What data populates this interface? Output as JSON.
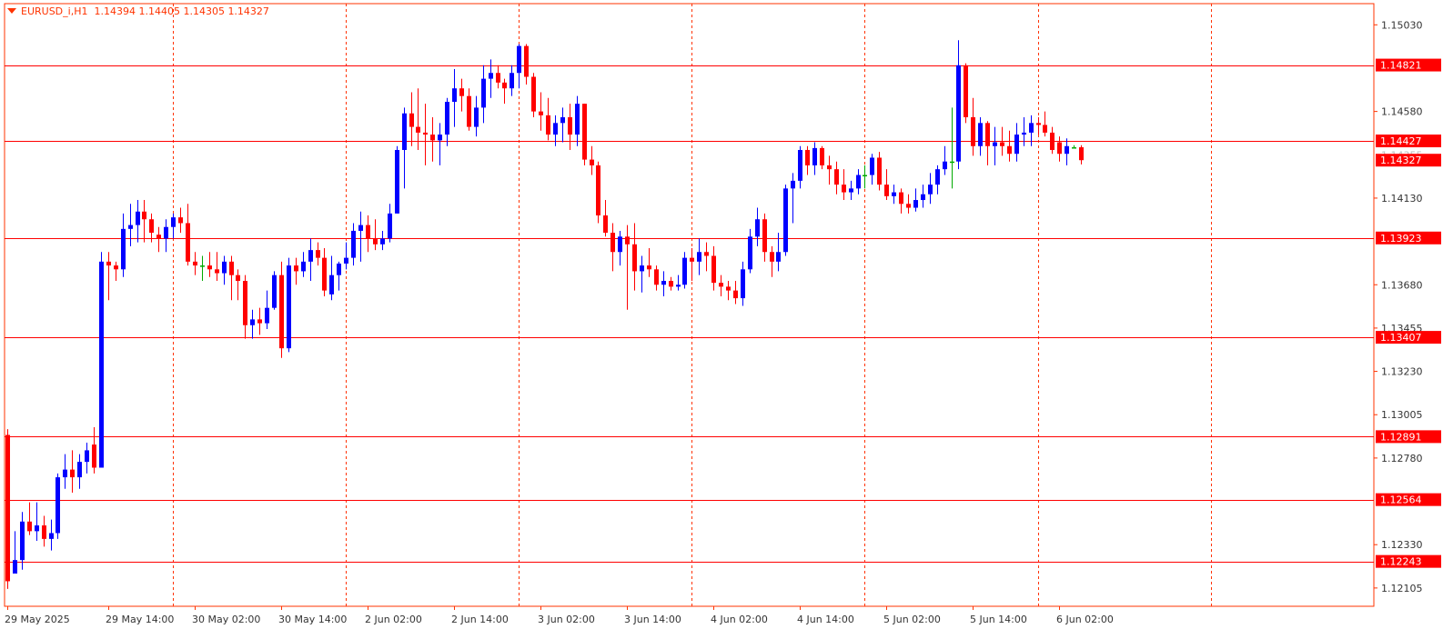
{
  "header": {
    "symbol": "EURUSD_i,H1",
    "ohlc": "1.14394 1.14405 1.14305 1.14327"
  },
  "colors": {
    "background": "#ffffff",
    "frame": "#ff3300",
    "grid": "#ff3300",
    "bull": "#0000ff",
    "bear": "#ff0000",
    "doji": "#00aa00",
    "hline": "#ff0000",
    "label_text": "#ffffff",
    "label_bg": "#ff0000"
  },
  "chart_data": {
    "type": "candlestick",
    "timeframe": "H1",
    "ylim": [
      1.1201,
      1.1514
    ],
    "price_ticks": [
      "1.15030",
      "1.14580",
      "1.14130",
      "1.13680",
      "1.13455",
      "1.13230",
      "1.13005",
      "1.12780",
      "1.12330",
      "1.12105"
    ],
    "time_labels": [
      {
        "label": "29 May 2025",
        "bar": 0
      },
      {
        "label": "29 May 14:00",
        "bar": 14
      },
      {
        "label": "30 May 02:00",
        "bar": 26
      },
      {
        "label": "30 May 14:00",
        "bar": 38
      },
      {
        "label": "2 Jun 02:00",
        "bar": 50
      },
      {
        "label": "2 Jun 14:00",
        "bar": 62
      },
      {
        "label": "3 Jun 02:00",
        "bar": 74
      },
      {
        "label": "3 Jun 14:00",
        "bar": 86
      },
      {
        "label": "4 Jun 02:00",
        "bar": 98
      },
      {
        "label": "4 Jun 14:00",
        "bar": 110
      },
      {
        "label": "5 Jun 02:00",
        "bar": 122
      },
      {
        "label": "5 Jun 14:00",
        "bar": 134
      },
      {
        "label": "6 Jun 02:00",
        "bar": 146
      }
    ],
    "grid_bars": [
      23,
      47,
      71,
      95,
      119,
      143,
      167
    ],
    "horizontal_levels": [
      {
        "value": 1.14821,
        "label": "1.14821"
      },
      {
        "value": 1.14427,
        "label": "1.14427"
      },
      {
        "value": 1.13923,
        "label": "1.13923"
      },
      {
        "value": 1.13407,
        "label": "1.13407"
      },
      {
        "value": 1.12891,
        "label": "1.12891"
      },
      {
        "value": 1.12564,
        "label": "1.12564"
      },
      {
        "value": 1.12243,
        "label": "1.12243"
      }
    ],
    "price_marker": {
      "value": 1.14327,
      "label": "1.14327"
    },
    "faded_tick": "1.14355",
    "candles": [
      [
        1.129,
        1.1293,
        1.121,
        1.1214
      ],
      [
        1.1218,
        1.124,
        1.1218,
        1.1225
      ],
      [
        1.1225,
        1.125,
        1.122,
        1.1245
      ],
      [
        1.1245,
        1.1255,
        1.1238,
        1.124
      ],
      [
        1.124,
        1.1255,
        1.1235,
        1.1243
      ],
      [
        1.1243,
        1.1248,
        1.1232,
        1.1236
      ],
      [
        1.1236,
        1.1246,
        1.123,
        1.1239
      ],
      [
        1.1239,
        1.127,
        1.1236,
        1.1268
      ],
      [
        1.1268,
        1.128,
        1.1262,
        1.1272
      ],
      [
        1.1272,
        1.1282,
        1.126,
        1.1268
      ],
      [
        1.1268,
        1.128,
        1.1262,
        1.1276
      ],
      [
        1.1276,
        1.1286,
        1.127,
        1.1282
      ],
      [
        1.1285,
        1.1294,
        1.127,
        1.1273
      ],
      [
        1.1273,
        1.1385,
        1.1273,
        1.138
      ],
      [
        1.138,
        1.1385,
        1.136,
        1.1378
      ],
      [
        1.1378,
        1.138,
        1.137,
        1.1376
      ],
      [
        1.1376,
        1.1405,
        1.1372,
        1.1397
      ],
      [
        1.1397,
        1.141,
        1.1388,
        1.1399
      ],
      [
        1.1399,
        1.1412,
        1.139,
        1.1406
      ],
      [
        1.1406,
        1.1412,
        1.139,
        1.1402
      ],
      [
        1.1402,
        1.1405,
        1.139,
        1.1395
      ],
      [
        1.1394,
        1.1398,
        1.1385,
        1.1392
      ],
      [
        1.1392,
        1.1402,
        1.1385,
        1.1398
      ],
      [
        1.1398,
        1.1405,
        1.1392,
        1.1403
      ],
      [
        1.1403,
        1.1408,
        1.1395,
        1.14
      ],
      [
        1.14,
        1.141,
        1.1378,
        1.138
      ],
      [
        1.138,
        1.1385,
        1.1373,
        1.1378
      ],
      [
        1.1378,
        1.1383,
        1.137,
        1.1378
      ],
      [
        1.1378,
        1.1385,
        1.1372,
        1.1376
      ],
      [
        1.1376,
        1.1385,
        1.137,
        1.1374
      ],
      [
        1.1374,
        1.1383,
        1.1368,
        1.138
      ],
      [
        1.138,
        1.1383,
        1.136,
        1.1373
      ],
      [
        1.1373,
        1.1376,
        1.136,
        1.137
      ],
      [
        1.137,
        1.1373,
        1.134,
        1.1347
      ],
      [
        1.1347,
        1.1355,
        1.134,
        1.135
      ],
      [
        1.135,
        1.1356,
        1.1342,
        1.1348
      ],
      [
        1.1348,
        1.1365,
        1.1345,
        1.1356
      ],
      [
        1.1356,
        1.1375,
        1.1355,
        1.1373
      ],
      [
        1.1373,
        1.138,
        1.133,
        1.1335
      ],
      [
        1.1335,
        1.1382,
        1.1333,
        1.1378
      ],
      [
        1.1378,
        1.1382,
        1.1368,
        1.1375
      ],
      [
        1.1375,
        1.1385,
        1.1372,
        1.138
      ],
      [
        1.138,
        1.1392,
        1.137,
        1.1386
      ],
      [
        1.1386,
        1.139,
        1.1378,
        1.1382
      ],
      [
        1.1382,
        1.1387,
        1.1362,
        1.1365
      ],
      [
        1.1363,
        1.1383,
        1.136,
        1.1373
      ],
      [
        1.1373,
        1.138,
        1.1365,
        1.1379
      ],
      [
        1.1379,
        1.139,
        1.1376,
        1.1382
      ],
      [
        1.1382,
        1.14,
        1.1378,
        1.1396
      ],
      [
        1.1396,
        1.1406,
        1.138,
        1.1399
      ],
      [
        1.1399,
        1.1404,
        1.1385,
        1.1392
      ],
      [
        1.1392,
        1.1402,
        1.1386,
        1.1389
      ],
      [
        1.1389,
        1.1396,
        1.1386,
        1.1392
      ],
      [
        1.1392,
        1.141,
        1.139,
        1.1405
      ],
      [
        1.1405,
        1.144,
        1.1405,
        1.1438
      ],
      [
        1.1438,
        1.146,
        1.1418,
        1.1457
      ],
      [
        1.1457,
        1.1468,
        1.144,
        1.145
      ],
      [
        1.145,
        1.147,
        1.1438,
        1.1447
      ],
      [
        1.1447,
        1.1462,
        1.143,
        1.1446
      ],
      [
        1.1446,
        1.1455,
        1.1432,
        1.1443
      ],
      [
        1.1443,
        1.1452,
        1.143,
        1.1446
      ],
      [
        1.1446,
        1.1465,
        1.144,
        1.1463
      ],
      [
        1.1463,
        1.148,
        1.145,
        1.147
      ],
      [
        1.147,
        1.1475,
        1.1458,
        1.1466
      ],
      [
        1.1466,
        1.147,
        1.1448,
        1.145
      ],
      [
        1.145,
        1.1466,
        1.1445,
        1.146
      ],
      [
        1.146,
        1.1482,
        1.1452,
        1.1475
      ],
      [
        1.1475,
        1.1485,
        1.1465,
        1.1478
      ],
      [
        1.1478,
        1.1482,
        1.147,
        1.1473
      ],
      [
        1.1473,
        1.1475,
        1.1462,
        1.147
      ],
      [
        1.147,
        1.1482,
        1.1466,
        1.1478
      ],
      [
        1.1478,
        1.1493,
        1.147,
        1.1492
      ],
      [
        1.1492,
        1.1493,
        1.1472,
        1.1476
      ],
      [
        1.1476,
        1.1478,
        1.1455,
        1.1458
      ],
      [
        1.1458,
        1.1468,
        1.1448,
        1.1456
      ],
      [
        1.1456,
        1.1465,
        1.1443,
        1.1446
      ],
      [
        1.1446,
        1.1456,
        1.144,
        1.1452
      ],
      [
        1.1452,
        1.146,
        1.1442,
        1.1455
      ],
      [
        1.1455,
        1.1462,
        1.1438,
        1.1446
      ],
      [
        1.1446,
        1.1466,
        1.144,
        1.1462
      ],
      [
        1.1462,
        1.1462,
        1.143,
        1.1433
      ],
      [
        1.1433,
        1.144,
        1.1425,
        1.143
      ],
      [
        1.143,
        1.1432,
        1.14,
        1.1404
      ],
      [
        1.1404,
        1.1412,
        1.1393,
        1.1395
      ],
      [
        1.1395,
        1.14,
        1.1375,
        1.1385
      ],
      [
        1.1385,
        1.1396,
        1.1378,
        1.1393
      ],
      [
        1.1393,
        1.1399,
        1.1355,
        1.1389
      ],
      [
        1.1389,
        1.14,
        1.1365,
        1.1375
      ],
      [
        1.1375,
        1.1383,
        1.1364,
        1.1378
      ],
      [
        1.1378,
        1.1387,
        1.1372,
        1.1376
      ],
      [
        1.1376,
        1.1378,
        1.1365,
        1.1368
      ],
      [
        1.1368,
        1.1375,
        1.1362,
        1.137
      ],
      [
        1.137,
        1.1372,
        1.1365,
        1.1367
      ],
      [
        1.1367,
        1.1373,
        1.1365,
        1.1368
      ],
      [
        1.1368,
        1.1385,
        1.1366,
        1.1382
      ],
      [
        1.1382,
        1.1387,
        1.137,
        1.138
      ],
      [
        1.138,
        1.1392,
        1.1373,
        1.1385
      ],
      [
        1.1385,
        1.139,
        1.1375,
        1.1383
      ],
      [
        1.1383,
        1.1388,
        1.1365,
        1.1369
      ],
      [
        1.1369,
        1.1373,
        1.1362,
        1.1367
      ],
      [
        1.1367,
        1.137,
        1.136,
        1.1365
      ],
      [
        1.1365,
        1.137,
        1.1358,
        1.1361
      ],
      [
        1.1361,
        1.138,
        1.1357,
        1.1376
      ],
      [
        1.1376,
        1.1397,
        1.1374,
        1.1393
      ],
      [
        1.1393,
        1.1408,
        1.1388,
        1.1402
      ],
      [
        1.1402,
        1.1405,
        1.138,
        1.1385
      ],
      [
        1.1385,
        1.1388,
        1.1372,
        1.138
      ],
      [
        1.138,
        1.1395,
        1.1375,
        1.1385
      ],
      [
        1.1385,
        1.142,
        1.1383,
        1.1418
      ],
      [
        1.1418,
        1.1426,
        1.14,
        1.1422
      ],
      [
        1.1422,
        1.144,
        1.1418,
        1.1438
      ],
      [
        1.1438,
        1.144,
        1.1425,
        1.143
      ],
      [
        1.143,
        1.1442,
        1.1425,
        1.1439
      ],
      [
        1.1439,
        1.144,
        1.1428,
        1.143
      ],
      [
        1.143,
        1.1435,
        1.142,
        1.1428
      ],
      [
        1.1428,
        1.1432,
        1.1415,
        1.142
      ],
      [
        1.142,
        1.1428,
        1.1412,
        1.1416
      ],
      [
        1.1416,
        1.1422,
        1.1412,
        1.1418
      ],
      [
        1.1418,
        1.1428,
        1.1415,
        1.1425
      ],
      [
        1.1425,
        1.143,
        1.1418,
        1.1425
      ],
      [
        1.1425,
        1.1436,
        1.142,
        1.1434
      ],
      [
        1.1434,
        1.1437,
        1.1417,
        1.142
      ],
      [
        1.142,
        1.1428,
        1.1412,
        1.1414
      ],
      [
        1.1414,
        1.142,
        1.141,
        1.1416
      ],
      [
        1.1416,
        1.1418,
        1.1405,
        1.141
      ],
      [
        1.141,
        1.1415,
        1.1405,
        1.1408
      ],
      [
        1.1408,
        1.1418,
        1.1406,
        1.1412
      ],
      [
        1.1412,
        1.142,
        1.1408,
        1.1415
      ],
      [
        1.1415,
        1.1426,
        1.141,
        1.142
      ],
      [
        1.142,
        1.143,
        1.1415,
        1.1428
      ],
      [
        1.1428,
        1.144,
        1.1425,
        1.1432
      ],
      [
        1.1432,
        1.146,
        1.1418,
        1.1432
      ],
      [
        1.1432,
        1.1495,
        1.1428,
        1.1482
      ],
      [
        1.1482,
        1.1483,
        1.1452,
        1.1455
      ],
      [
        1.1455,
        1.1465,
        1.1435,
        1.144
      ],
      [
        1.144,
        1.1455,
        1.1435,
        1.1452
      ],
      [
        1.1452,
        1.1453,
        1.143,
        1.144
      ],
      [
        1.144,
        1.145,
        1.143,
        1.1442
      ],
      [
        1.1442,
        1.145,
        1.1435,
        1.144
      ],
      [
        1.144,
        1.1448,
        1.1432,
        1.1436
      ],
      [
        1.1436,
        1.1452,
        1.1432,
        1.1446
      ],
      [
        1.1446,
        1.1455,
        1.144,
        1.1447
      ],
      [
        1.1447,
        1.1456,
        1.144,
        1.1452
      ],
      [
        1.1452,
        1.1455,
        1.1446,
        1.1451
      ],
      [
        1.1451,
        1.1458,
        1.1445,
        1.1447
      ],
      [
        1.1447,
        1.145,
        1.1436,
        1.1438
      ],
      [
        1.1442,
        1.1445,
        1.1432,
        1.1436
      ],
      [
        1.1436,
        1.1444,
        1.143,
        1.144
      ],
      [
        1.14394,
        1.14405,
        1.14394,
        1.14394
      ],
      [
        1.14394,
        1.14405,
        1.14305,
        1.14327
      ]
    ]
  }
}
